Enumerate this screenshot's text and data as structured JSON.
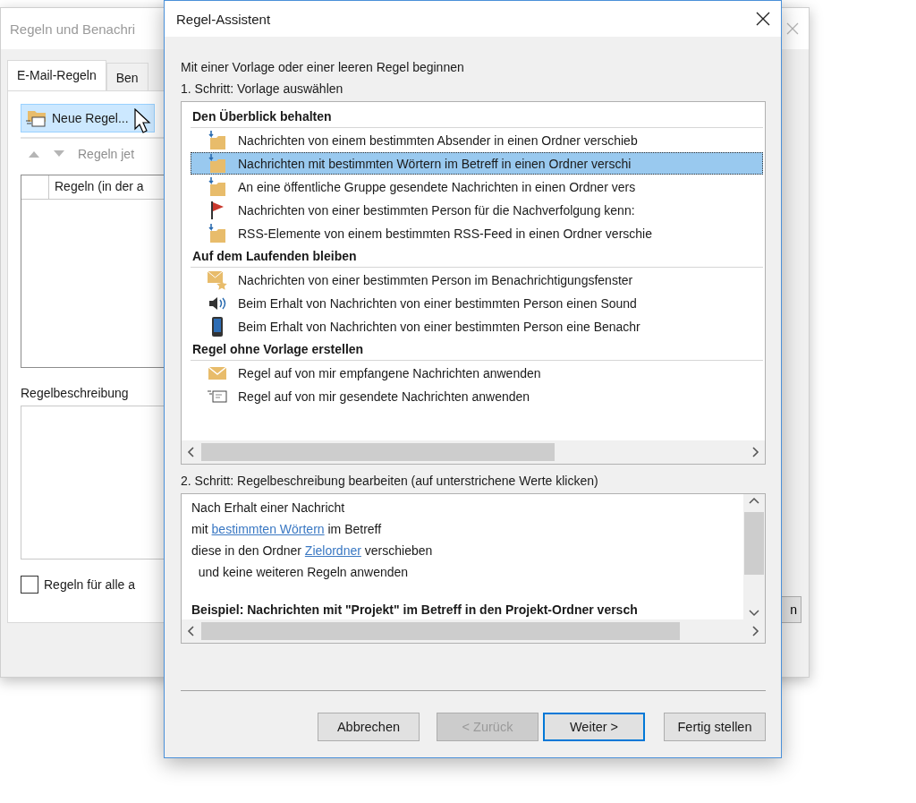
{
  "back_window": {
    "title": "Regeln und Benachri",
    "tabs": [
      {
        "label": "E-Mail-Regeln",
        "selected": true
      },
      {
        "label": "Ben",
        "selected": false
      }
    ],
    "new_rule_button": "Neue Regel...",
    "run_rules_button": {
      "label": "Regeln jet",
      "disabled": true
    },
    "rules_table": {
      "columns": [
        "Regeln (in der a"
      ]
    },
    "description_label": "Regelbeschreibung",
    "apply_all_checkbox": {
      "label": "Regeln für alle a",
      "checked": false
    },
    "button_fragment": "n"
  },
  "dialog": {
    "title": "Regel-Assistent",
    "intro": "Mit einer Vorlage oder einer leeren Regel beginnen",
    "step1_label": "1. Schritt: Vorlage auswählen",
    "template_groups": [
      {
        "heading": "Den Überblick behalten",
        "items": [
          {
            "label": "Nachrichten von einem bestimmten Absender in einen Ordner verschieb",
            "kind": "folder-move",
            "selected": false
          },
          {
            "label": "Nachrichten mit bestimmten Wörtern im Betreff in einen Ordner verschi",
            "kind": "folder-move",
            "selected": true
          },
          {
            "label": "An eine öffentliche Gruppe gesendete Nachrichten in einen Ordner vers",
            "kind": "folder-move",
            "selected": false
          },
          {
            "label": "Nachrichten von einer bestimmten Person für die Nachverfolgung kenn:",
            "kind": "flag",
            "selected": false
          },
          {
            "label": "RSS-Elemente von einem bestimmten RSS-Feed in einen Ordner verschie",
            "kind": "folder-move",
            "selected": false
          }
        ]
      },
      {
        "heading": "Auf dem Laufenden bleiben",
        "items": [
          {
            "label": "Nachrichten von einer bestimmten Person im Benachrichtigungsfenster",
            "kind": "mail-star",
            "selected": false
          },
          {
            "label": "Beim Erhalt von Nachrichten von einer bestimmten Person einen Sound",
            "kind": "speaker",
            "selected": false
          },
          {
            "label": "Beim Erhalt von Nachrichten von einer bestimmten Person eine Benachr",
            "kind": "phone",
            "selected": false
          }
        ]
      },
      {
        "heading": "Regel ohne Vorlage erstellen",
        "items": [
          {
            "label": "Regel auf von mir empfangene Nachrichten anwenden",
            "kind": "mail",
            "selected": false
          },
          {
            "label": "Regel auf von mir gesendete Nachrichten anwenden",
            "kind": "mail-sent",
            "selected": false
          }
        ]
      }
    ],
    "step2_label": "2. Schritt: Regelbeschreibung bearbeiten (auf unterstrichene Werte klicken)",
    "description_lines": [
      [
        {
          "text": "Nach Erhalt einer Nachricht",
          "link": false
        }
      ],
      [
        {
          "text": "mit ",
          "link": false
        },
        {
          "text": "bestimmten Wörtern",
          "link": true
        },
        {
          "text": " im Betreff",
          "link": false
        }
      ],
      [
        {
          "text": "diese in den Ordner ",
          "link": false
        },
        {
          "text": "Zielordner",
          "link": true
        },
        {
          "text": " verschieben",
          "link": false
        }
      ],
      [
        {
          "text": "  und keine weiteren Regeln anwenden",
          "link": false
        }
      ]
    ],
    "example": "Beispiel: Nachrichten mit \"Projekt\" im Betreff in den Projekt-Ordner versch",
    "buttons": [
      {
        "label": "Abbrechen",
        "disabled": false,
        "default": false
      },
      {
        "label": "< Zurück",
        "disabled": true,
        "default": false
      },
      {
        "label": "Weiter >",
        "disabled": false,
        "default": true
      },
      {
        "label": "Fertig stellen",
        "disabled": false,
        "default": false
      }
    ]
  }
}
